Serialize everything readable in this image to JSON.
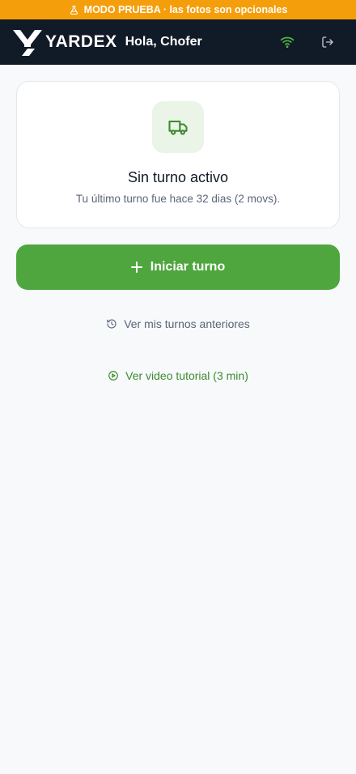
{
  "banner": {
    "icon": "flask-icon",
    "text": "MODO PRUEBA · las fotos son opcionales",
    "color": "#f59e0b"
  },
  "header": {
    "brand": "YARDEX",
    "greeting": "Hola, Chofer",
    "connection_icon": "wifi-icon",
    "logout_icon": "logout-icon",
    "background": "#111a27"
  },
  "status_card": {
    "icon": "truck-icon",
    "title": "Sin turno activo",
    "subtitle": "Tu último turno fue hace 32 dias (2 movs)."
  },
  "actions": {
    "start_shift": {
      "icon": "plus-icon",
      "label": "Iniciar turno",
      "color": "#4fa63e"
    },
    "history": {
      "icon": "history-icon",
      "label": "Ver mis turnos anteriores"
    },
    "tutorial": {
      "icon": "play-circle-icon",
      "label": "Ver video tutorial (3 min)"
    }
  }
}
